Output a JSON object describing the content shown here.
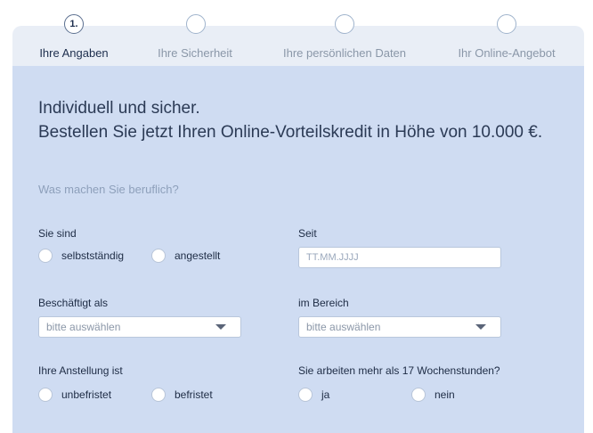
{
  "steps": [
    {
      "number": "1.",
      "label": "Ihre Angaben"
    },
    {
      "number": "",
      "label": "Ihre Sicherheit"
    },
    {
      "number": "",
      "label": "Ihre persönlichen Daten"
    },
    {
      "number": "",
      "label": "Ihr Online-Angebot"
    }
  ],
  "heading": {
    "line1": "Individuell und sicher.",
    "line2": "Bestellen Sie jetzt Ihren Online-Vorteilskredit in Höhe von 10.000 €."
  },
  "subheading": "Was machen Sie beruflich?",
  "form": {
    "sie_sind": {
      "label": "Sie sind",
      "options": [
        "selbstständig",
        "angestellt"
      ]
    },
    "seit": {
      "label": "Seit",
      "placeholder": "TT.MM.JJJJ"
    },
    "beschaeftigt_als": {
      "label": "Beschäftigt als",
      "value": "bitte auswählen"
    },
    "im_bereich": {
      "label": "im Bereich",
      "value": "bitte auswählen"
    },
    "anstellung": {
      "label": "Ihre Anstellung ist",
      "options": [
        "unbefristet",
        "befristet"
      ]
    },
    "wochenstunden": {
      "label": "Sie arbeiten mehr als 17 Wochenstunden?",
      "options": [
        "ja",
        "nein"
      ]
    }
  }
}
